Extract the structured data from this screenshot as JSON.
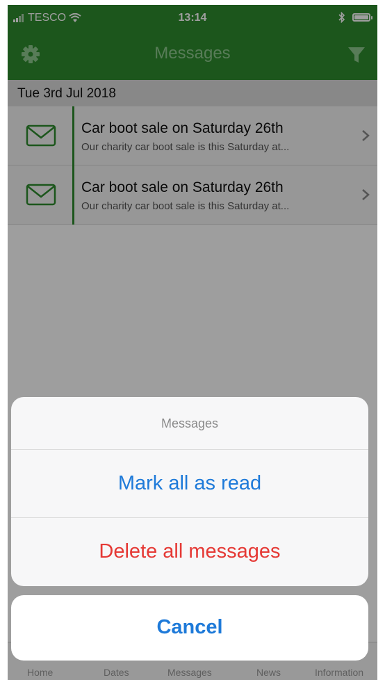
{
  "status_bar": {
    "carrier": "TESCO",
    "time": "13:14"
  },
  "nav": {
    "title": "Messages"
  },
  "list": {
    "section_date": "Tue 3rd Jul 2018",
    "messages": [
      {
        "title": "Car boot sale on Saturday 26th",
        "snippet": "Our charity car boot sale is this Saturday at..."
      },
      {
        "title": "Car boot sale on Saturday 26th",
        "snippet": "Our charity car boot sale is this Saturday at..."
      }
    ]
  },
  "tabbar": {
    "tabs": [
      "Home",
      "Dates",
      "Messages",
      "News",
      "Information"
    ]
  },
  "action_sheet": {
    "title": "Messages",
    "mark_read_label": "Mark all as read",
    "delete_label": "Delete all messages",
    "cancel_label": "Cancel"
  },
  "colors": {
    "brand_green": "#2e8b2e",
    "action_blue": "#1e7ad9",
    "destructive_red": "#e53935"
  }
}
